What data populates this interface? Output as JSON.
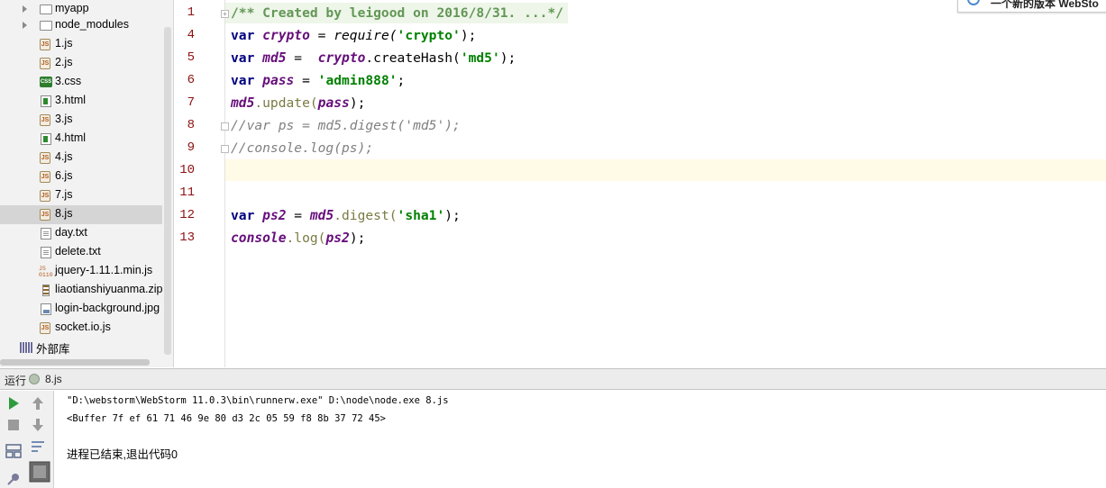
{
  "project_tree": {
    "items": [
      {
        "label": "myapp",
        "type": "folder",
        "expandable": true,
        "selected": false
      },
      {
        "label": "node_modules",
        "type": "folder",
        "expandable": true,
        "selected": false
      },
      {
        "label": "1.js",
        "type": "js",
        "selected": false
      },
      {
        "label": "2.js",
        "type": "js",
        "selected": false
      },
      {
        "label": "3.css",
        "type": "css",
        "selected": false
      },
      {
        "label": "3.html",
        "type": "html",
        "selected": false
      },
      {
        "label": "3.js",
        "type": "js",
        "selected": false
      },
      {
        "label": "4.html",
        "type": "html",
        "selected": false
      },
      {
        "label": "4.js",
        "type": "js",
        "selected": false
      },
      {
        "label": "6.js",
        "type": "js",
        "selected": false
      },
      {
        "label": "7.js",
        "type": "js",
        "selected": false
      },
      {
        "label": "8.js",
        "type": "js",
        "selected": true
      },
      {
        "label": "day.txt",
        "type": "txt",
        "selected": false
      },
      {
        "label": "delete.txt",
        "type": "txt",
        "selected": false
      },
      {
        "label": "jquery-1.11.1.min.js",
        "type": "min",
        "selected": false
      },
      {
        "label": "liaotianshiyuanma.zip",
        "type": "zip",
        "selected": false
      },
      {
        "label": "login-background.jpg",
        "type": "img",
        "selected": false
      },
      {
        "label": "socket.io.js",
        "type": "js",
        "selected": false
      },
      {
        "label": "外部库",
        "type": "lib",
        "expandable": true,
        "selected": false
      }
    ]
  },
  "editor": {
    "line_numbers": [
      "1",
      "4",
      "5",
      "6",
      "7",
      "8",
      "9",
      "10",
      "11",
      "12",
      "13"
    ],
    "current_line": "10",
    "lines": {
      "l1": {
        "comment": "/** Created by leigood on 2016/8/31. ...*/"
      },
      "l4": {
        "kw": "var",
        "name": "crypto",
        "eq": " = ",
        "call": "require(",
        "arg": "'crypto'",
        "end": ");"
      },
      "l5": {
        "kw": "var",
        "name": "md5",
        "eq": " =  ",
        "obj": "crypto",
        "call": ".createHash(",
        "arg": "'md5'",
        "end": ");"
      },
      "l6": {
        "kw": "var",
        "name": "pass",
        "eq": " = ",
        "arg": "'admin888'",
        "end": ";"
      },
      "l7": {
        "obj": "md5",
        "call": ".update(",
        "arg": "pass",
        "end": ");"
      },
      "l8": {
        "comment": "//var ps = md5.digest('md5');"
      },
      "l9": {
        "comment": "//console.log(ps);"
      },
      "l12": {
        "kw": "var",
        "name": "ps2",
        "eq": " = ",
        "obj": "md5",
        "call": ".digest(",
        "arg": "'sha1'",
        "end": ");"
      },
      "l13": {
        "obj": "console",
        "call": ".log(",
        "arg": "ps2",
        "end": ");"
      }
    }
  },
  "notification": {
    "text": "一个新的版本 WebSto"
  },
  "run_panel": {
    "label": "运行",
    "tab_name": "8.js",
    "output": [
      "\"D:\\webstorm\\WebStorm 11.0.3\\bin\\runnerw.exe\" D:\\node\\node.exe 8.js",
      "<Buffer 7f ef 61 71 46 9e 80 d3 2c 05 59 f8 8b 37 72 45>",
      "进程已结束,退出代码0"
    ]
  },
  "colors": {
    "keyword": "#000080",
    "string": "#008000",
    "comment": "#808080",
    "line_number": "#8e1010",
    "run_green": "#2e9b3e"
  }
}
